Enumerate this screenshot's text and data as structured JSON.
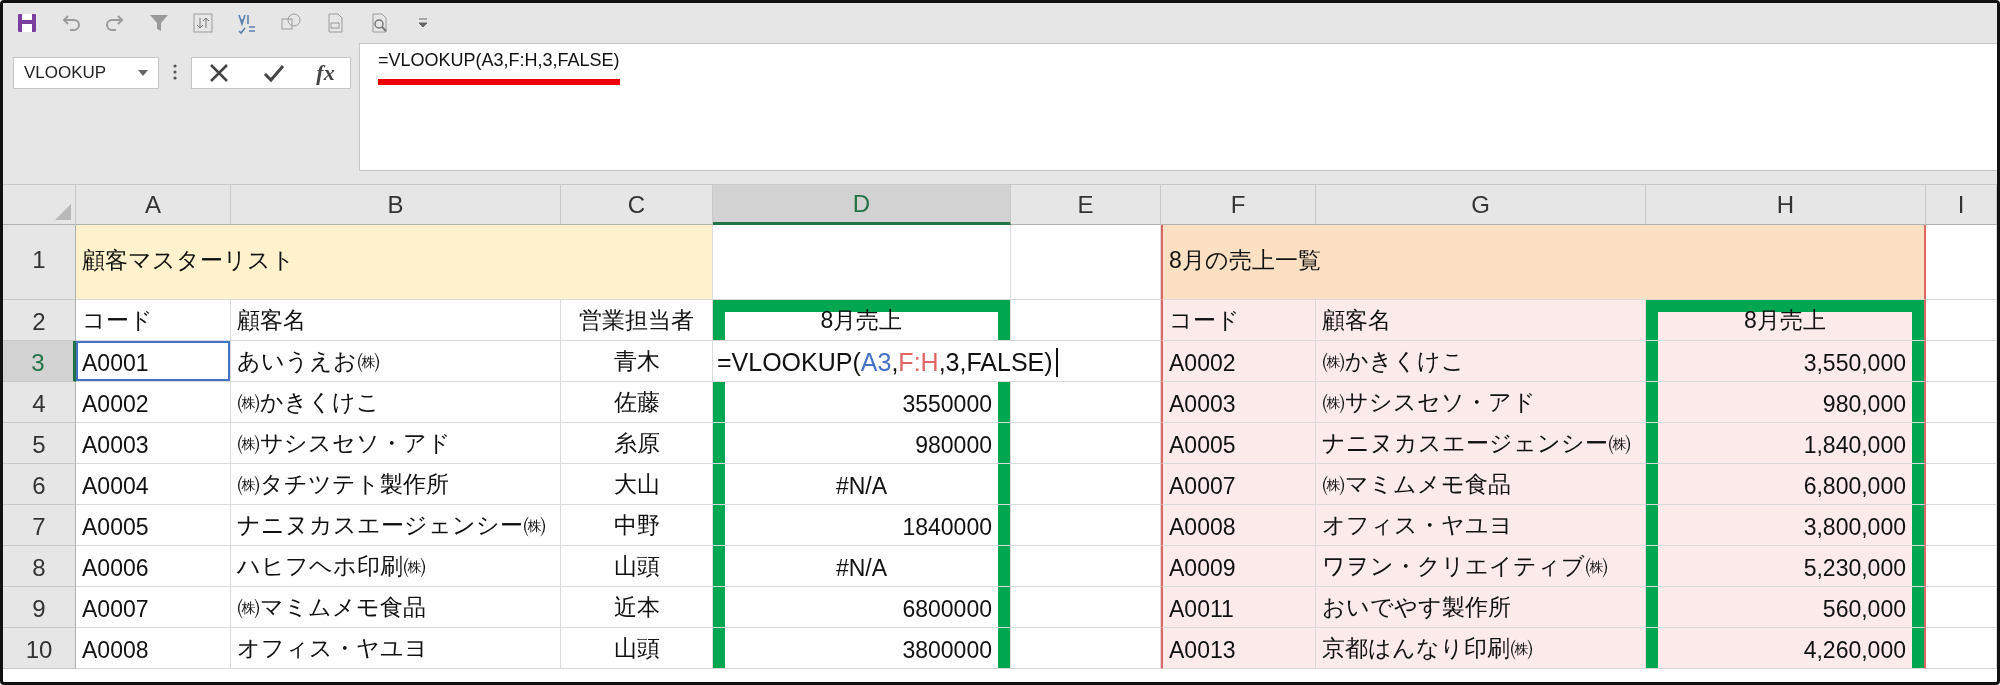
{
  "name_box": {
    "value": "VLOOKUP"
  },
  "formula_bar": {
    "function_button": "fx",
    "value": "=VLOOKUP(A3,F:H,3,FALSE)",
    "underlined": true
  },
  "columns": [
    {
      "label": "A",
      "selected": false,
      "kind": "text",
      "boxed": false
    },
    {
      "label": "B",
      "selected": false,
      "kind": "text",
      "boxed": false
    },
    {
      "label": "C",
      "selected": false,
      "kind": "person",
      "boxed": false
    },
    {
      "label": "D",
      "selected": true,
      "kind": "amount",
      "boxed": true
    },
    {
      "label": "E",
      "selected": false,
      "kind": "text",
      "boxed": false
    },
    {
      "label": "F",
      "selected": false,
      "kind": "text",
      "color": "#fdeaea",
      "boxed": false,
      "range_left_edge": true
    },
    {
      "label": "G",
      "selected": false,
      "kind": "text",
      "color": "#fdeaea",
      "boxed": false
    },
    {
      "label": "H",
      "selected": false,
      "kind": "amount",
      "color": "#fdeaea",
      "boxed": true,
      "range_right_edge": true
    },
    {
      "label": "I",
      "selected": false,
      "kind": "text",
      "boxed": false
    }
  ],
  "rows": [
    {
      "number": "1",
      "selected": false,
      "cells": {
        "A": {
          "kind": "title",
          "text": "顧客マスターリスト",
          "color": "#fff2cc"
        },
        "B": {
          "kind": "title",
          "color": "#fff2cc"
        },
        "C": {
          "kind": "title",
          "color": "#fff2cc"
        },
        "F": {
          "kind": "title",
          "text": "8月の売上一覧",
          "color": "#fbe0c4"
        },
        "G": {
          "kind": "title",
          "color": "#fbe0c4"
        },
        "H": {
          "kind": "title",
          "color": "#fbe0c4"
        }
      }
    },
    {
      "number": "2",
      "selected": false,
      "cells": {
        "A": "コード",
        "B": "顧客名",
        "C": "営業担当者",
        "D": {
          "text": "8月売上",
          "kind": "centered"
        },
        "F": "コード",
        "G": "顧客名",
        "H": {
          "text": "8月売上",
          "kind": "centered"
        }
      }
    },
    {
      "number": "3",
      "selected": true,
      "cells": {
        "A": {
          "kind": "reference",
          "text": "A0001",
          "color": "#4472c4"
        },
        "B": "あいうえお㈱",
        "C": "青木",
        "D": {
          "editing": true,
          "parts": [
            {
              "text": "=VLOOKUP("
            },
            {
              "text": "A3",
              "color": "#4472c4"
            },
            {
              "text": ","
            },
            {
              "text": "F:H",
              "color": "#e06666"
            },
            {
              "text": ",3,FALSE)"
            }
          ]
        },
        "F": "A0002",
        "G": "㈱かきくけこ",
        "H": "3,550,000"
      }
    },
    {
      "number": "4",
      "selected": false,
      "cells": {
        "A": "A0002",
        "B": "㈱かきくけこ",
        "C": "佐藤",
        "D": "3550000",
        "F": "A0003",
        "G": "㈱サシスセソ・アド",
        "H": "980,000"
      }
    },
    {
      "number": "5",
      "selected": false,
      "cells": {
        "A": "A0003",
        "B": "㈱サシスセソ・アド",
        "C": "糸原",
        "D": "980000",
        "F": "A0005",
        "G": "ナニヌカスエージェンシー㈱",
        "H": "1,840,000"
      }
    },
    {
      "number": "6",
      "selected": false,
      "cells": {
        "A": "A0004",
        "B": "㈱タチツテト製作所",
        "C": "大山",
        "D": {
          "text": "#N/A",
          "kind": "centered"
        },
        "F": "A0007",
        "G": "㈱マミムメモ食品",
        "H": "6,800,000"
      }
    },
    {
      "number": "7",
      "selected": false,
      "cells": {
        "A": "A0005",
        "B": "ナニヌカスエージェンシー㈱",
        "C": "中野",
        "D": "1840000",
        "F": "A0008",
        "G": "オフィス・ヤユヨ",
        "H": "3,800,000"
      }
    },
    {
      "number": "8",
      "selected": false,
      "cells": {
        "A": "A0006",
        "B": "ハヒフヘホ印刷㈱",
        "C": "山頭",
        "D": {
          "text": "#N/A",
          "kind": "centered"
        },
        "F": "A0009",
        "G": "ワヲン・クリエイティブ㈱",
        "H": "5,230,000"
      }
    },
    {
      "number": "9",
      "selected": false,
      "cells": {
        "A": "A0007",
        "B": "㈱マミムメモ食品",
        "C": "近本",
        "D": "6800000",
        "F": "A0011",
        "G": "おいでやす製作所",
        "H": "560,000"
      }
    },
    {
      "number": "10",
      "selected": false,
      "cells": {
        "A": "A0008",
        "B": "オフィス・ヤユヨ",
        "C": "山頭",
        "D": "3800000",
        "F": "A0013",
        "G": "京都はんなり印刷㈱",
        "H": "4,260,000"
      }
    }
  ]
}
